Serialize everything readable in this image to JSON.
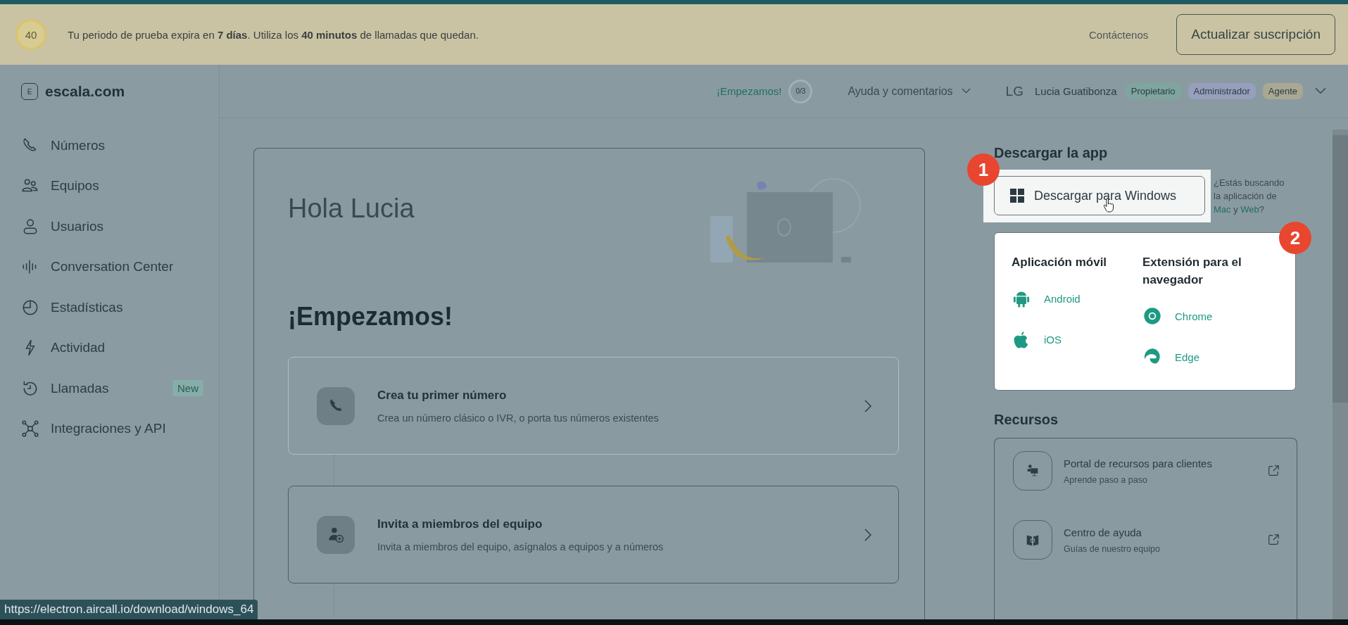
{
  "trial_banner": {
    "counter": "40",
    "message": "Tu periodo de prueba expira en **7 días**. Utiliza los **40 minutos** de llamadas que quedan.",
    "contact_link": "Contáctenos",
    "upgrade_button": "Actualizar suscripción"
  },
  "logo": {
    "badge": "E",
    "name": "escala.com"
  },
  "header": {
    "onboarding_link": "¡Empezamos!",
    "progress": "0/3",
    "help_menu": "Ayuda y comentarios",
    "user": {
      "initials": "LG",
      "name": "Lucia Guatibonza"
    },
    "roles": [
      {
        "label": "Propietario",
        "color": "#7ea59e"
      },
      {
        "label": "Administrador",
        "color": "#979fbd"
      },
      {
        "label": "Agente",
        "color": "#a9a893"
      }
    ]
  },
  "sidebar": {
    "items": [
      {
        "kind": "phone",
        "label": "Números"
      },
      {
        "kind": "team",
        "label": "Equipos"
      },
      {
        "kind": "user",
        "label": "Usuarios"
      },
      {
        "kind": "wave",
        "label": "Conversation Center"
      },
      {
        "kind": "pie",
        "label": "Estadísticas"
      },
      {
        "kind": "bolt",
        "label": "Actividad"
      },
      {
        "kind": "history",
        "label": "Llamadas",
        "badge": "New"
      },
      {
        "kind": "network",
        "label": "Integraciones y API"
      }
    ]
  },
  "main": {
    "greeting": "Hola Lucia",
    "section_title": "¡Empezamos!",
    "tasks": [
      {
        "kind": "phone",
        "title": "Crea tu primer número",
        "description": "Crea un número clásico o IVR, o porta tus números existentes",
        "highlighted": true
      },
      {
        "kind": "invite",
        "title": "Invita a miembros del equipo",
        "description": "Invita a miembros del equipo, asígnalos a equipos y a números",
        "highlighted": false
      }
    ]
  },
  "download": {
    "title": "Descargar la app",
    "windows_button": "Descargar para Windows",
    "note": {
      "before": "¿Estás buscando la aplicación de",
      "link_1": "Mac",
      "between": "y",
      "link_2": "Web",
      "after": "?"
    },
    "mobile": {
      "title": "Aplicación móvil",
      "links": [
        {
          "kind": "android",
          "label": "Android"
        },
        {
          "kind": "apple",
          "label": "iOS"
        }
      ]
    },
    "browser": {
      "title": "Extensión para el navegador",
      "links": [
        {
          "kind": "chrome",
          "label": "Chrome"
        },
        {
          "kind": "edge",
          "label": "Edge"
        }
      ]
    }
  },
  "step_markers": [
    "1",
    "2"
  ],
  "resources": {
    "title": "Recursos",
    "items": [
      {
        "kind": "portal",
        "title": "Portal de recursos para clientes",
        "subtitle": "Aprende paso a paso"
      },
      {
        "kind": "help",
        "title": "Centro de ayuda",
        "subtitle": "Guías de nuestro equipo"
      }
    ]
  },
  "status_url": "https://electron.aircall.io/download/windows_64"
}
